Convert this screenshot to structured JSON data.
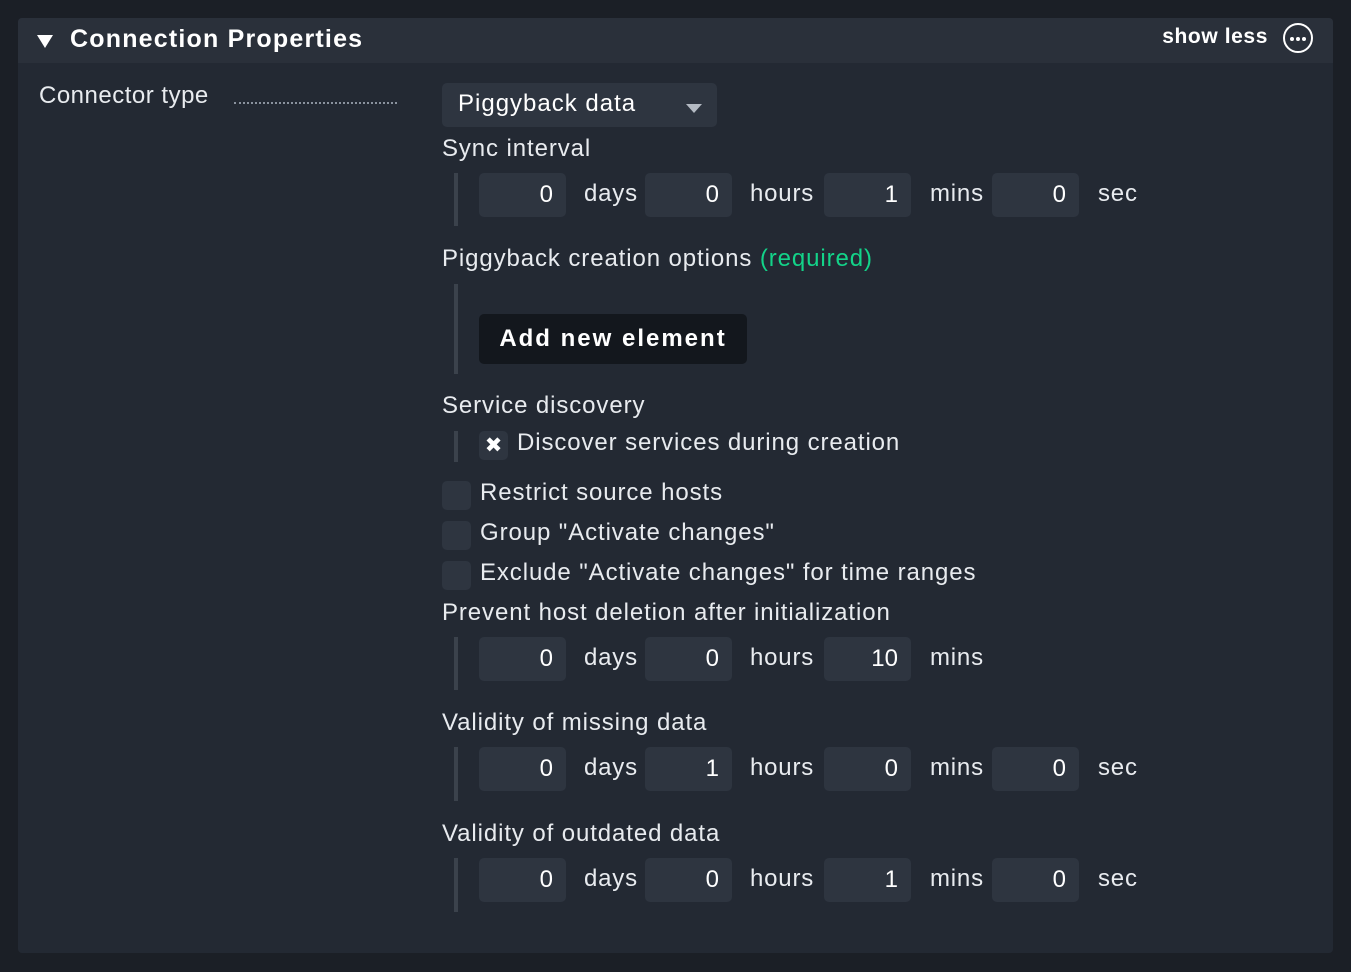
{
  "header": {
    "title": "Connection Properties",
    "show_less_label": "show less",
    "toggle_icon": "triangle-down-icon",
    "more_icon": "ellipsis-circle-icon"
  },
  "connector_type": {
    "label": "Connector type",
    "selected": "Piggyback data"
  },
  "sync_interval": {
    "label": "Sync interval",
    "days": "0",
    "days_unit": "days",
    "hours": "0",
    "hours_unit": "hours",
    "mins": "1",
    "mins_unit": "mins",
    "secs": "0",
    "secs_unit": "sec"
  },
  "piggyback_creation": {
    "label": "Piggyback creation options",
    "required_label": "(required)",
    "add_button_label": "Add new element"
  },
  "service_discovery": {
    "label": "Service discovery",
    "checkbox_label": "Discover services during creation",
    "checked_mark": "✖"
  },
  "options": {
    "restrict_source_hosts": "Restrict source hosts",
    "group_activate_changes": "Group \"Activate changes\"",
    "exclude_activate_changes": "Exclude \"Activate changes\" for time ranges"
  },
  "prevent_deletion": {
    "label": "Prevent host deletion after initialization",
    "days": "0",
    "days_unit": "days",
    "hours": "0",
    "hours_unit": "hours",
    "mins": "10",
    "mins_unit": "mins"
  },
  "validity_missing": {
    "label": "Validity of missing data",
    "days": "0",
    "days_unit": "days",
    "hours": "1",
    "hours_unit": "hours",
    "mins": "0",
    "mins_unit": "mins",
    "secs": "0",
    "secs_unit": "sec"
  },
  "validity_outdated": {
    "label": "Validity of outdated data",
    "days": "0",
    "days_unit": "days",
    "hours": "0",
    "hours_unit": "hours",
    "mins": "1",
    "mins_unit": "mins",
    "secs": "0",
    "secs_unit": "sec"
  },
  "colors": {
    "background": "#1b1f26",
    "panel": "#232933",
    "header": "#2a303a",
    "input": "#2e3540",
    "required_accent": "#13d389",
    "button": "#13171d"
  }
}
